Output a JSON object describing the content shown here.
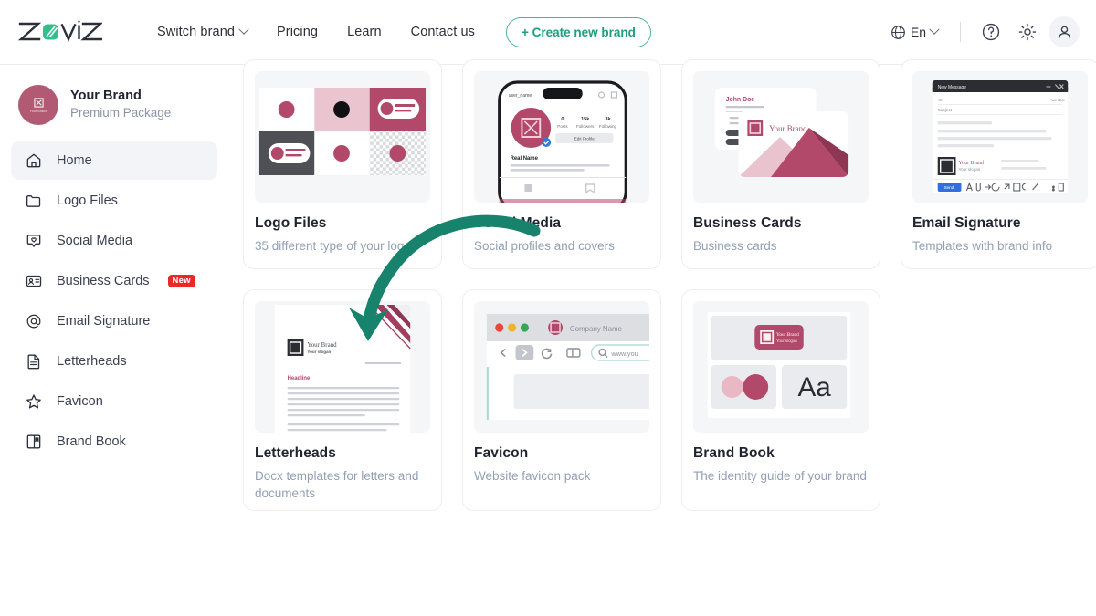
{
  "header": {
    "logo_text": "ZoViZ",
    "nav": [
      {
        "label": "Switch brand",
        "has_chevron": true,
        "icon": "chevron-down-icon"
      },
      {
        "label": "Pricing",
        "has_chevron": false
      },
      {
        "label": "Learn",
        "has_chevron": false
      },
      {
        "label": "Contact us",
        "has_chevron": false
      }
    ],
    "create_button": "+ Create new brand",
    "language": "En",
    "icons": [
      "globe-icon",
      "chevron-down-icon",
      "help-circle-icon",
      "gear-icon",
      "user-avatar-icon"
    ]
  },
  "sidebar": {
    "brand": {
      "name": "Your Brand",
      "package": "Premium Package",
      "avatar_label": "Your Brand"
    },
    "items": [
      {
        "label": "Home",
        "icon": "home-icon",
        "active": true,
        "badge": ""
      },
      {
        "label": "Logo Files",
        "icon": "folder-icon",
        "active": false,
        "badge": ""
      },
      {
        "label": "Social Media",
        "icon": "chat-heart-icon",
        "active": false,
        "badge": ""
      },
      {
        "label": "Business Cards",
        "icon": "id-card-icon",
        "active": false,
        "badge": "New"
      },
      {
        "label": "Email Signature",
        "icon": "at-sign-icon",
        "active": false,
        "badge": ""
      },
      {
        "label": "Letterheads",
        "icon": "document-icon",
        "active": false,
        "badge": ""
      },
      {
        "label": "Favicon",
        "icon": "star-icon",
        "active": false,
        "badge": ""
      },
      {
        "label": "Brand Book",
        "icon": "book-icon",
        "active": false,
        "badge": ""
      }
    ]
  },
  "cards": [
    {
      "title": "Logo Files",
      "desc": "35 different type of your logo",
      "thumb": "logo-grid-thumbnail"
    },
    {
      "title": "Social Media",
      "desc": "Social profiles and covers",
      "thumb": "phone-profile-thumbnail"
    },
    {
      "title": "Business Cards",
      "desc": "Business cards",
      "thumb": "business-cards-thumbnail"
    },
    {
      "title": "Email Signature",
      "desc": "Templates with brand info",
      "thumb": "email-window-thumbnail"
    },
    {
      "title": "Letterheads",
      "desc": "Docx templates for letters and documents",
      "thumb": "letterhead-thumbnail"
    },
    {
      "title": "Favicon",
      "desc": "Website favicon pack",
      "thumb": "browser-window-thumbnail"
    },
    {
      "title": "Brand Book",
      "desc": "The identity guide of your brand",
      "thumb": "brand-book-thumbnail"
    }
  ],
  "thumbnails": {
    "social": {
      "user_handle": "user_name",
      "posts_count": "0",
      "posts_label": "Posts",
      "followers_count": "15k",
      "followers_label": "Followers",
      "following_count": "3k",
      "following_label": "Following",
      "edit_button": "Edit Profile",
      "real_name": "Real Name"
    },
    "business_card": {
      "name": "John Doe",
      "brand": "Your Brand"
    },
    "favicon": {
      "tab_title": "Company Name",
      "url": "www.you"
    },
    "letterhead": {
      "brand": "Your Brand",
      "tagline": "Your slogan",
      "headline": "Headline"
    },
    "brand_book": {
      "type_sample": "Aa",
      "brand": "Your Brand"
    },
    "email": {
      "window_title": "New Message",
      "to_label": "To",
      "subject_label": "Subject",
      "cc_bcc": "Cc Bcc",
      "send_label": "Send",
      "signature_name": "Your Brand"
    }
  },
  "annotation": {
    "arrow": "curved-arrow-annotation",
    "color": "#17836c",
    "points_to": "Letterheads"
  },
  "colors": {
    "accent_teal": "#1d9e80",
    "brand_maroon": "#b2486a",
    "brand_pink": "#e7b9c6",
    "badge_red": "#ef2626",
    "text_dark": "#1f2430",
    "text_muted": "#93a0b4"
  }
}
